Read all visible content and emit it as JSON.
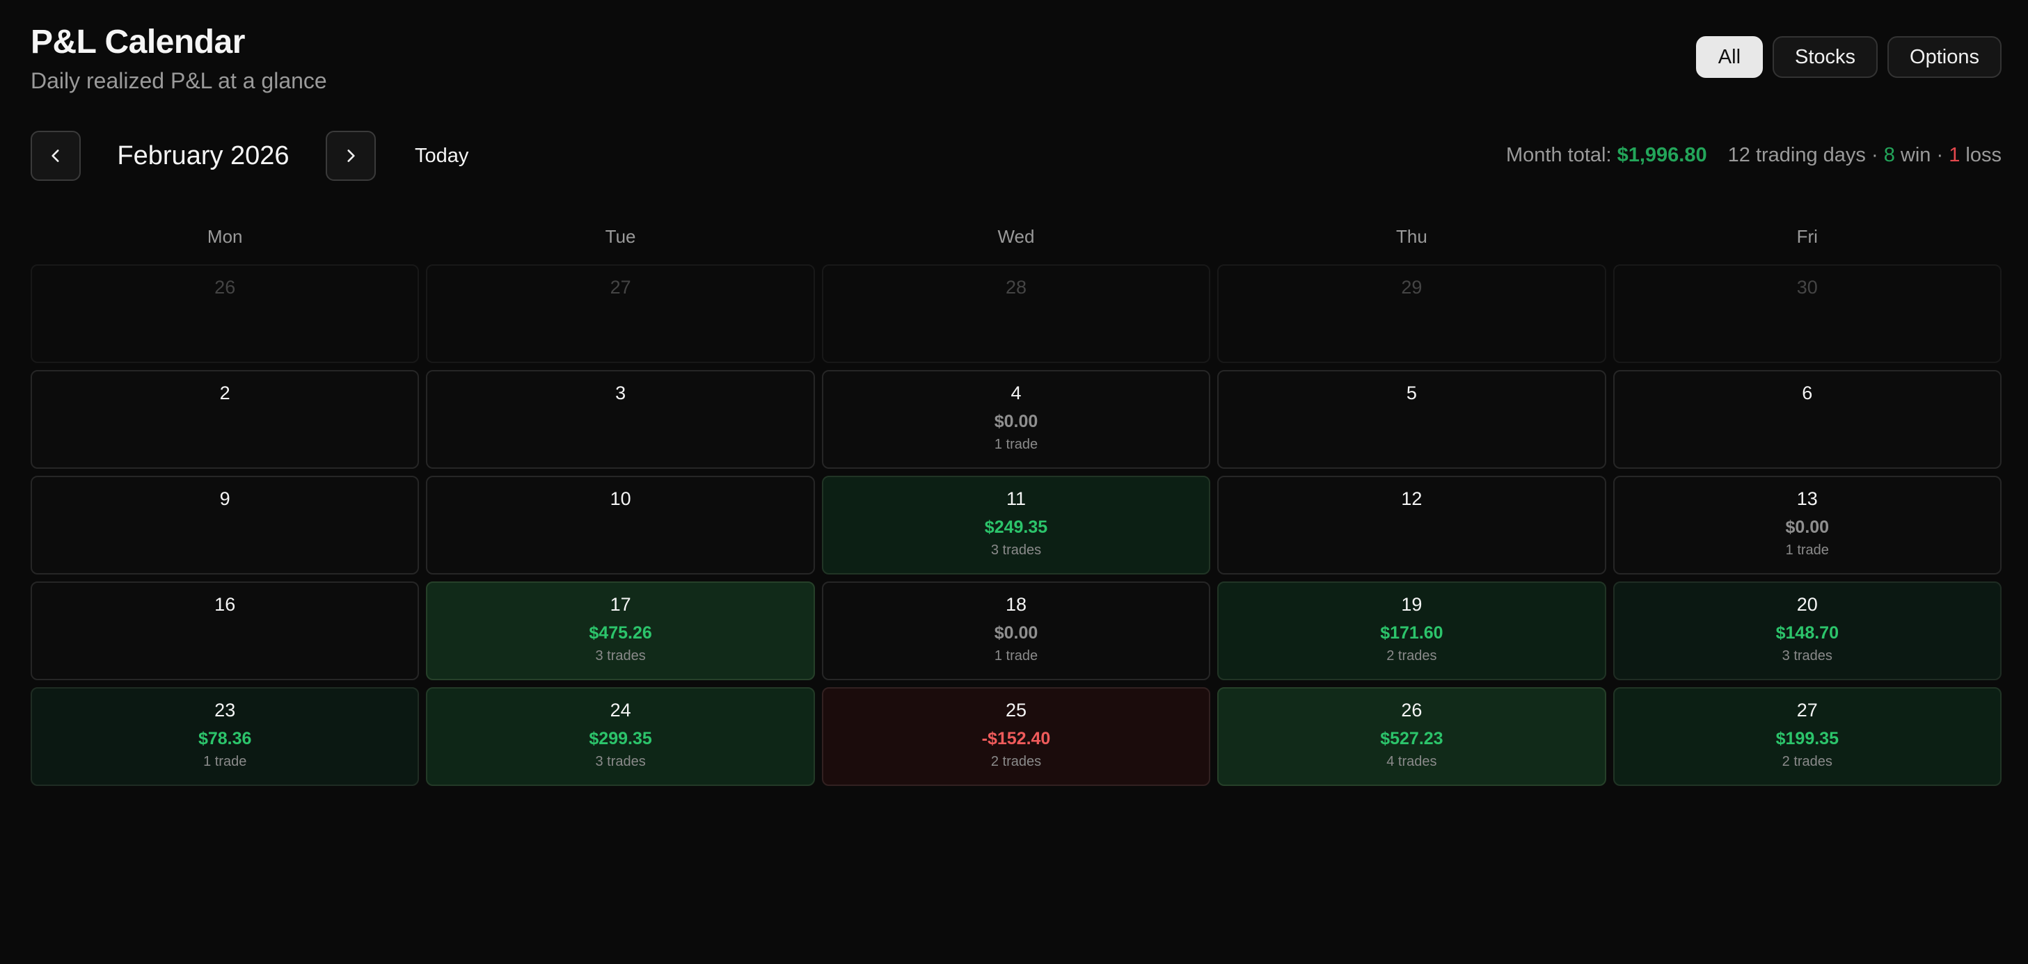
{
  "header": {
    "title": "P&L Calendar",
    "subtitle": "Daily realized P&L at a glance"
  },
  "filters": {
    "all": "All",
    "stocks": "Stocks",
    "options": "Options",
    "selected": "All"
  },
  "nav": {
    "prev_icon": "chevron-left-icon",
    "next_icon": "chevron-right-icon",
    "month_label": "February 2026",
    "today_label": "Today"
  },
  "summary": {
    "month_total_label": "Month total:",
    "month_total_value": "$1,996.80",
    "trading_days": "12 trading days",
    "sep1": " · ",
    "win_count": "8",
    "win_label": " win",
    "sep2": " · ",
    "loss_count": "1",
    "loss_label": " loss"
  },
  "weekdays": [
    "Mon",
    "Tue",
    "Wed",
    "Thu",
    "Fri"
  ],
  "colors": {
    "background": "#0a0a0a",
    "gain": "#2cc46b",
    "loss": "#ef5b5b",
    "neutral": "#8f8f8f"
  },
  "days": [
    {
      "day": "26",
      "outside": true
    },
    {
      "day": "27",
      "outside": true
    },
    {
      "day": "28",
      "outside": true
    },
    {
      "day": "29",
      "outside": true
    },
    {
      "day": "30",
      "outside": true
    },
    {
      "day": "2"
    },
    {
      "day": "3"
    },
    {
      "day": "4",
      "pnl": "$0.00",
      "trades": "1 trade",
      "status": "zero"
    },
    {
      "day": "5"
    },
    {
      "day": "6"
    },
    {
      "day": "9"
    },
    {
      "day": "10"
    },
    {
      "day": "11",
      "pnl": "$249.35",
      "trades": "3 trades",
      "status": "gain",
      "level": 2
    },
    {
      "day": "12"
    },
    {
      "day": "13",
      "pnl": "$0.00",
      "trades": "1 trade",
      "status": "zero"
    },
    {
      "day": "16"
    },
    {
      "day": "17",
      "pnl": "$475.26",
      "trades": "3 trades",
      "status": "gain",
      "level": 4
    },
    {
      "day": "18",
      "pnl": "$0.00",
      "trades": "1 trade",
      "status": "zero"
    },
    {
      "day": "19",
      "pnl": "$171.60",
      "trades": "2 trades",
      "status": "gain",
      "level": 2
    },
    {
      "day": "20",
      "pnl": "$148.70",
      "trades": "3 trades",
      "status": "gain",
      "level": 1
    },
    {
      "day": "23",
      "pnl": "$78.36",
      "trades": "1 trade",
      "status": "gain",
      "level": 1
    },
    {
      "day": "24",
      "pnl": "$299.35",
      "trades": "3 trades",
      "status": "gain",
      "level": 3
    },
    {
      "day": "25",
      "pnl": "-$152.40",
      "trades": "2 trades",
      "status": "loss",
      "level": 1
    },
    {
      "day": "26",
      "pnl": "$527.23",
      "trades": "4 trades",
      "status": "gain",
      "level": 4
    },
    {
      "day": "27",
      "pnl": "$199.35",
      "trades": "2 trades",
      "status": "gain",
      "level": 2
    }
  ]
}
